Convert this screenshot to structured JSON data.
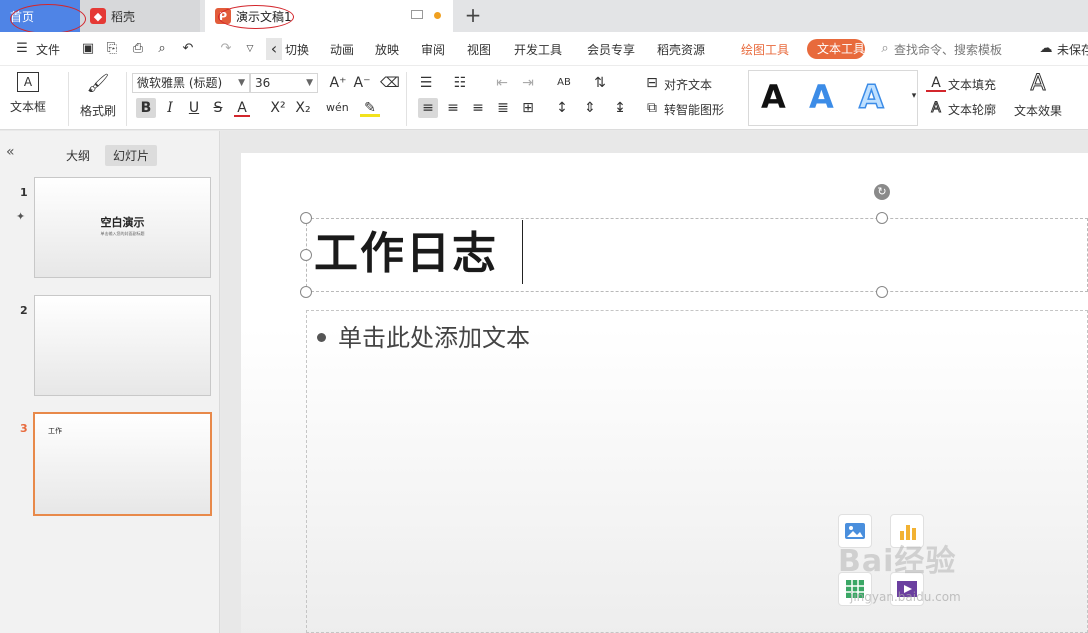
{
  "tabs": {
    "home": "首页",
    "daoke": "稻壳",
    "doc": "演示文稿1",
    "add": "+"
  },
  "menu": {
    "file": "文件",
    "back_arrow": "‹",
    "items": [
      "切换",
      "动画",
      "放映",
      "审阅",
      "视图",
      "开发工具",
      "会员专享",
      "稻壳资源"
    ],
    "drawing_tools": "绘图工具",
    "text_tools": "文本工具",
    "search": "查找命令、搜索模板",
    "unsaved": "未保存"
  },
  "ribbon": {
    "textbox": "文本框",
    "format_painter": "格式刷",
    "font_name": "微软雅黑 (标题)",
    "font_size": "36",
    "align_text": "对齐文本",
    "smartart": "转智能图形",
    "text_fill": "文本填充",
    "text_outline": "文本轮廓",
    "text_effect": "文本效果",
    "style_glyph": "A"
  },
  "panel": {
    "outline_tab": "大纲",
    "slides_tab": "幻灯片",
    "slides": [
      {
        "num": "1",
        "title": "空白演示",
        "sub": "单击输入您的封面副标题"
      },
      {
        "num": "2",
        "title": ""
      },
      {
        "num": "3",
        "title": "工作"
      }
    ]
  },
  "slide": {
    "title": "工作日志",
    "body": "单击此处添加文本"
  },
  "watermark": {
    "brand": "Bai经验",
    "url": "jingyan.baidu.com"
  },
  "colors": {
    "accent": "#e86a3c",
    "home_tab": "#4f84e6",
    "annotation": "#d3262c"
  }
}
